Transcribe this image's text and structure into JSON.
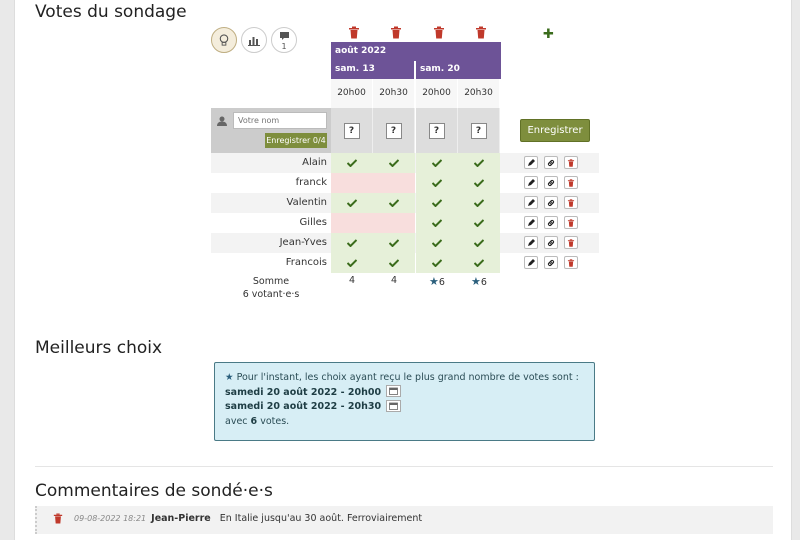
{
  "sections": {
    "votes_title": "Votes du sondage",
    "best_title": "Meilleurs choix",
    "comments_title": "Commentaires de sondé·e·s"
  },
  "toolbar": {
    "comment_count": "1"
  },
  "header": {
    "month": "août 2022",
    "days": [
      "sam. 13",
      "sam. 20"
    ],
    "hours": [
      "20h00",
      "20h30",
      "20h00",
      "20h30"
    ]
  },
  "new_vote": {
    "name_placeholder": "Votre nom",
    "save_small": "Enregistrer 0/4",
    "choice_mark": "?",
    "save_big": "Enregistrer"
  },
  "voters": [
    {
      "name": "Alain",
      "votes": [
        "yes",
        "yes",
        "yes",
        "yes"
      ]
    },
    {
      "name": "franck",
      "votes": [
        "no",
        "no",
        "yes",
        "yes"
      ]
    },
    {
      "name": "Valentin",
      "votes": [
        "yes",
        "yes",
        "yes",
        "yes"
      ]
    },
    {
      "name": "Gilles",
      "votes": [
        "no",
        "no",
        "yes",
        "yes"
      ]
    },
    {
      "name": "Jean-Yves",
      "votes": [
        "yes",
        "yes",
        "yes",
        "yes"
      ]
    },
    {
      "name": "Francois",
      "votes": [
        "yes",
        "yes",
        "yes",
        "yes"
      ]
    }
  ],
  "summary": {
    "label": "Somme",
    "voters_count": "6 votant·e·s",
    "totals": [
      "4",
      "4",
      "6",
      "6"
    ],
    "star": "★"
  },
  "best": {
    "star": "★",
    "intro": "Pour l'instant, les choix ayant reçu le plus grand nombre de votes sont :",
    "choices": [
      "samedi 20 août 2022 - 20h00",
      "samedi 20 août 2022 - 20h30"
    ],
    "with": "avec",
    "count": "6",
    "votes": "votes."
  },
  "comment": {
    "date": "09-08-2022 18:21",
    "author": "Jean-Pierre",
    "text": "En Italie jusqu'au 30 août. Ferroviairement"
  },
  "colors": {
    "purple": "#6d5397",
    "yes": "#e6f0d9",
    "no": "#f8dedd",
    "olive": "#7e8e3d",
    "info": "#d7eef5"
  }
}
